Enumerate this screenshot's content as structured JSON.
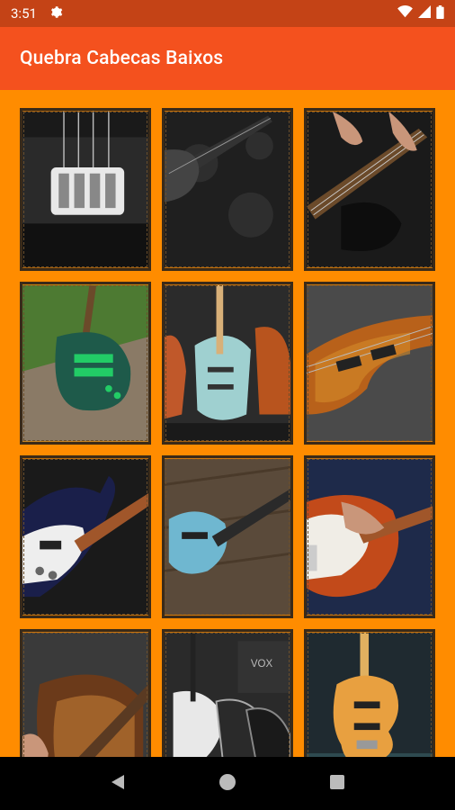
{
  "status_bar": {
    "time": "3:51",
    "icons": [
      "gear-icon",
      "wifi-icon",
      "signal-icon",
      "battery-icon"
    ]
  },
  "app_bar": {
    "title": "Quebra Cabecas Baixos"
  },
  "gallery": {
    "tiles": [
      {
        "name": "bass-pickups-closeup",
        "bg": "#2a2a2a"
      },
      {
        "name": "bass-on-damask",
        "bg": "#1f1f1f"
      },
      {
        "name": "hands-playing-bass",
        "bg": "#1a1a1a"
      },
      {
        "name": "green-bass-on-wood",
        "bg": "#3f6b2a"
      },
      {
        "name": "basses-lineup",
        "bg": "#2b2b2b"
      },
      {
        "name": "quilted-top-bass",
        "bg": "#4a4a4a"
      },
      {
        "name": "rickenbacker-bass",
        "bg": "#1a1a1a"
      },
      {
        "name": "blue-bass-on-floor",
        "bg": "#5a4a3a"
      },
      {
        "name": "sunburst-bass-player",
        "bg": "#1e2a4a"
      },
      {
        "name": "bass-close-neck",
        "bg": "#3a3a3a"
      },
      {
        "name": "basses-with-amp",
        "bg": "#2a2a2a"
      },
      {
        "name": "natural-jazz-bass",
        "bg": "#1f2a30"
      }
    ]
  },
  "colors": {
    "status_bar": "#c44316",
    "app_bar": "#f4511e",
    "background": "#ff8c00"
  },
  "nav_bar": {
    "icons": [
      "back-icon",
      "home-icon",
      "recents-icon"
    ]
  }
}
